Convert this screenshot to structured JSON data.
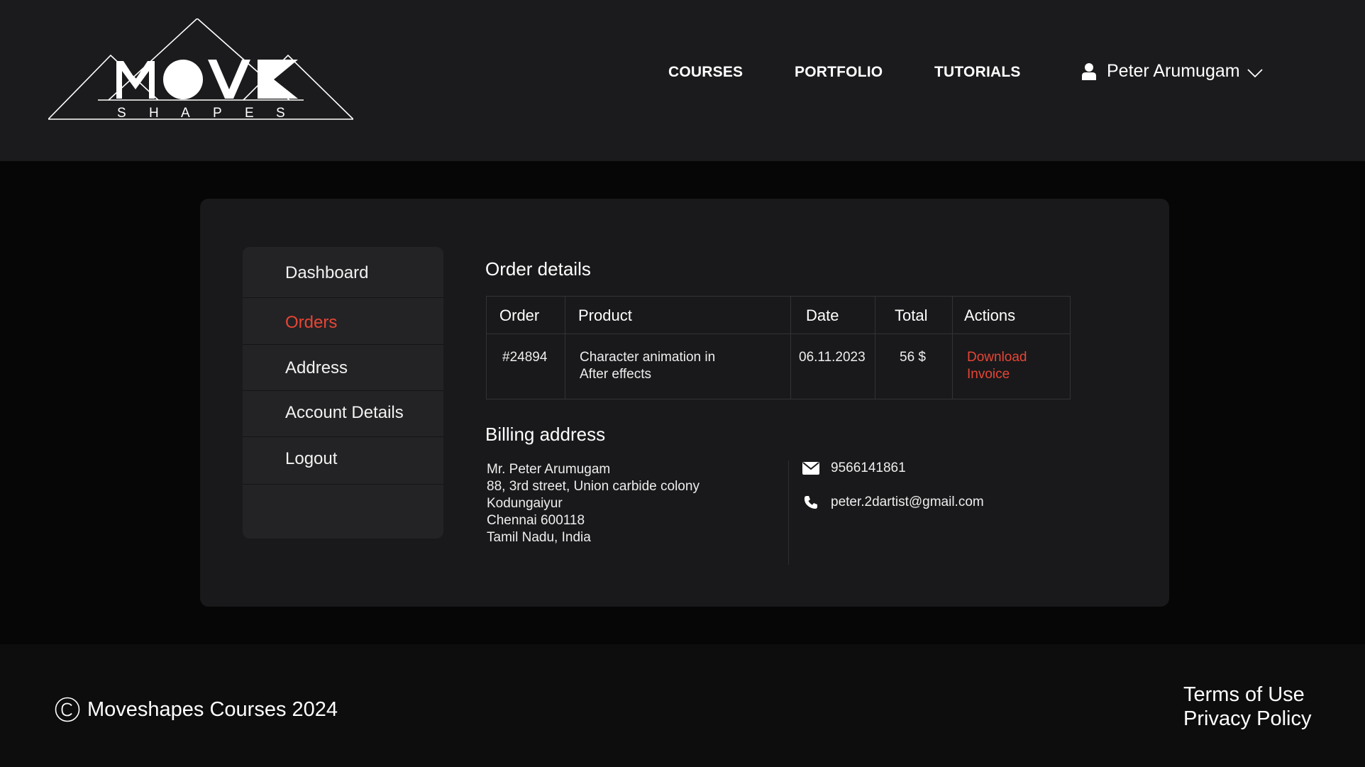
{
  "header": {
    "logo": {
      "word": "MOVE",
      "subtitle_letters": [
        "S",
        "H",
        "A",
        "P",
        "E",
        "S"
      ]
    },
    "nav": [
      {
        "label": "COURSES"
      },
      {
        "label": "PORTFOLIO"
      },
      {
        "label": "TUTORIALS"
      }
    ],
    "user": {
      "name": "Peter Arumugam",
      "icon": "user-icon",
      "dropdown_icon": "chevron-down-icon"
    }
  },
  "sidebar": {
    "items": [
      {
        "label": "Dashboard",
        "active": false
      },
      {
        "label": "Orders",
        "active": true
      },
      {
        "label": "Address",
        "active": false
      },
      {
        "label": "Account Details",
        "active": false
      },
      {
        "label": "Logout",
        "active": false
      }
    ]
  },
  "order_details": {
    "title": "Order details",
    "columns": [
      "Order",
      "Product",
      "Date",
      "Total",
      "Actions"
    ],
    "rows": [
      {
        "order": "#24894",
        "product_line1": "Character animation in",
        "product_line2": "After effects",
        "date": "06.11.2023",
        "total": "56 $",
        "action_line1": "Download",
        "action_line2": "Invoice"
      }
    ]
  },
  "billing": {
    "title": "Billing address",
    "address_lines": [
      "Mr. Peter Arumugam",
      "88, 3rd street, Union carbide colony",
      "Kodungaiyur",
      "Chennai 600118",
      "Tamil Nadu, India"
    ],
    "phone": "9566141861",
    "email": "peter.2dartist@gmail.com",
    "phone_icon": "envelope-icon",
    "email_icon": "phone-icon"
  },
  "footer": {
    "copyright": "Moveshapes Courses 2024",
    "links": [
      "Terms of Use",
      "Privacy Policy"
    ]
  },
  "colors": {
    "accent": "#e84535",
    "header_bg": "#1b1b1d",
    "page_bg": "#060606",
    "card_bg": "#19191b",
    "sidebar_bg": "#232325"
  }
}
